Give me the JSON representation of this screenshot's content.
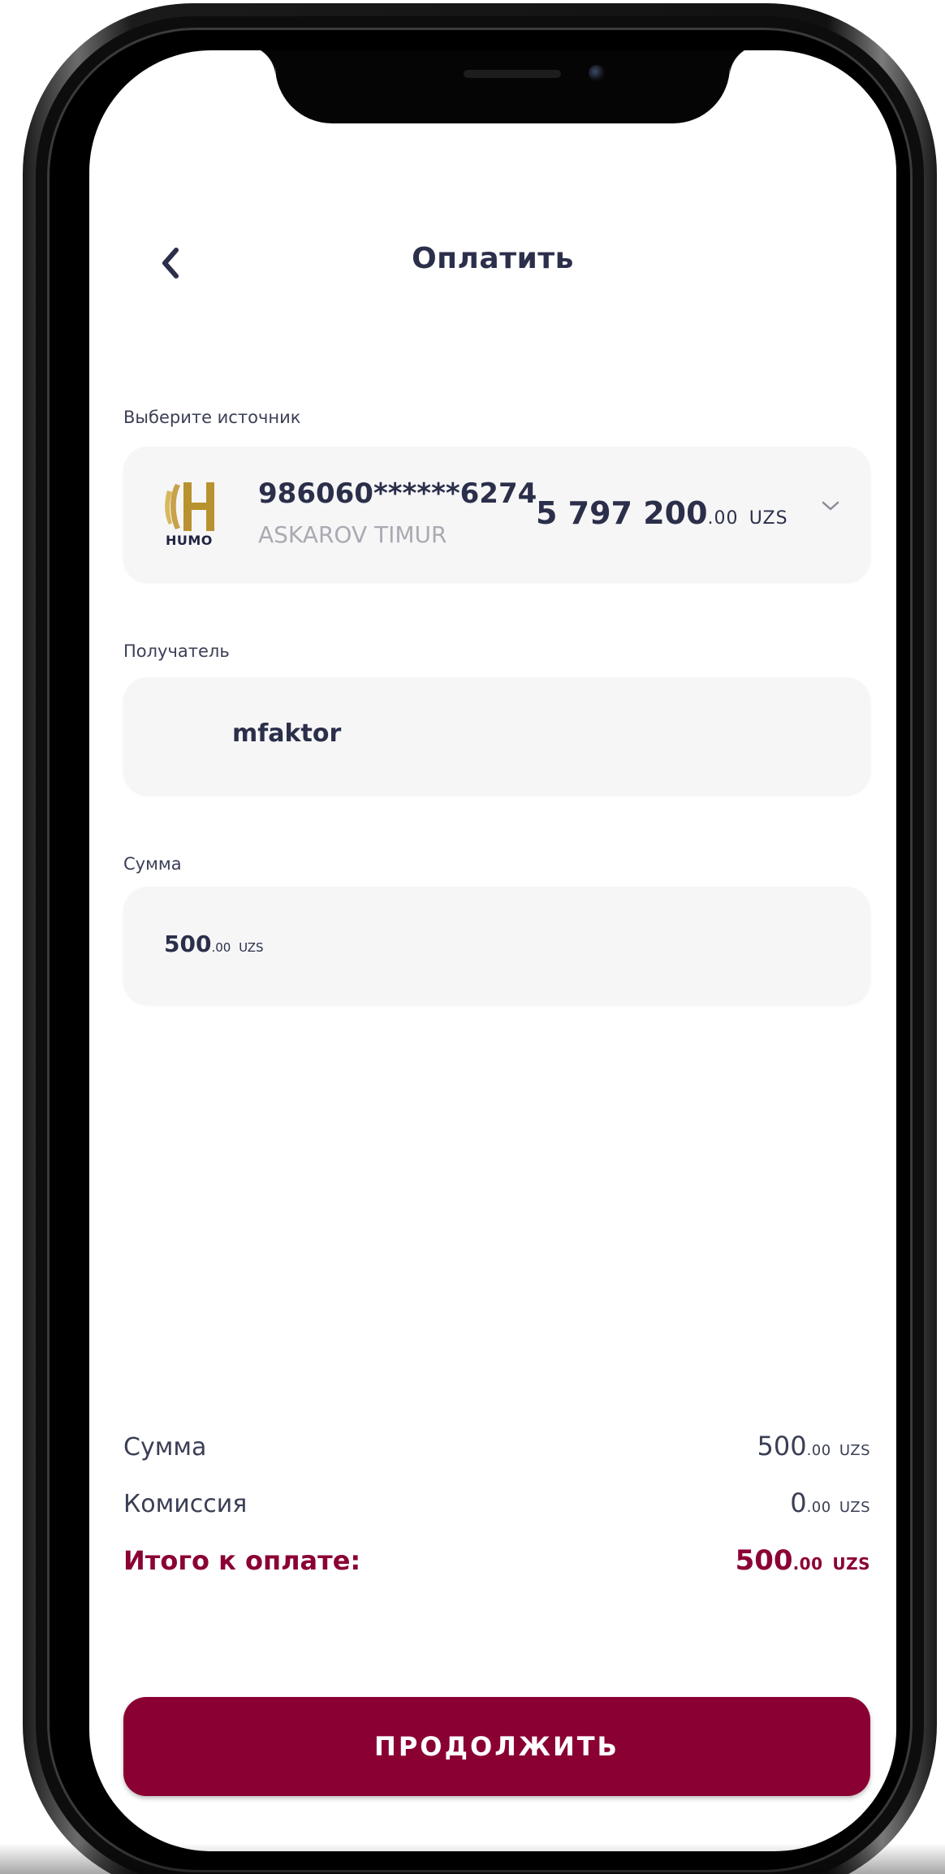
{
  "header": {
    "back_icon": "chevron-left-icon",
    "title": "Оплатить"
  },
  "source": {
    "label": "Выберите источник",
    "card_brand": "HUMO",
    "card_number": "986060******6274",
    "card_holder": "ASKAROV TIMUR",
    "balance_main": "5 797 200",
    "balance_fraction": ".00",
    "balance_currency": "UZS",
    "dropdown_icon": "chevron-down-icon"
  },
  "recipient": {
    "label": "Получатель",
    "value": "mfaktor"
  },
  "amount": {
    "label": "Сумма",
    "value_main": "500",
    "value_fraction": ".00",
    "value_currency": "UZS"
  },
  "summary": {
    "sum_label": "Сумма",
    "sum_main": "500",
    "sum_fraction": ".00",
    "sum_currency": "UZS",
    "commission_label": "Комиссия",
    "commission_main": "0",
    "commission_fraction": ".00",
    "commission_currency": "UZS",
    "total_label": "Итого к оплате:",
    "total_main": "500",
    "total_fraction": ".00",
    "total_currency": "UZS"
  },
  "actions": {
    "continue_label": "ПРОДОЛЖИТЬ"
  },
  "colors": {
    "accent": "#8a0033",
    "text_primary": "#2b2f4a",
    "field_bg": "#f6f6f7",
    "humo_gold": "#b8922e"
  }
}
